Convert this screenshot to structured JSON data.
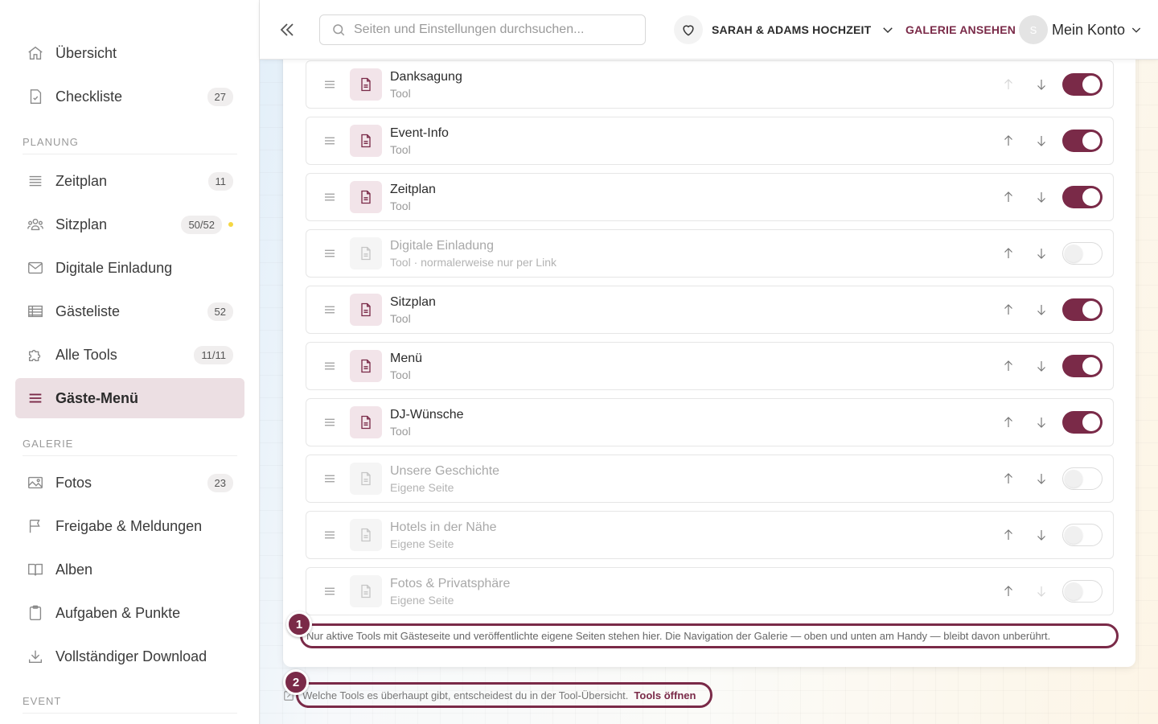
{
  "sidebar": {
    "items_top": [
      {
        "label": "Übersicht",
        "badge": ""
      },
      {
        "label": "Checkliste",
        "badge": "27"
      }
    ],
    "section_planung": "PLANUNG",
    "items_planung": [
      {
        "label": "Zeitplan",
        "badge": "11"
      },
      {
        "label": "Sitzplan",
        "badge": "50/52"
      },
      {
        "label": "Digitale Einladung",
        "badge": ""
      },
      {
        "label": "Gästeliste",
        "badge": "52"
      },
      {
        "label": "Alle Tools",
        "badge": "11/11"
      },
      {
        "label": "Gäste-Menü",
        "badge": ""
      }
    ],
    "section_galerie": "GALERIE",
    "items_galerie": [
      {
        "label": "Fotos",
        "badge": "23"
      },
      {
        "label": "Freigabe & Meldungen",
        "badge": ""
      },
      {
        "label": "Alben",
        "badge": ""
      },
      {
        "label": "Aufgaben & Punkte",
        "badge": ""
      },
      {
        "label": "Vollständiger Download",
        "badge": ""
      }
    ],
    "section_event": "EVENT"
  },
  "header": {
    "search_placeholder": "Seiten und Einstellungen durchsuchen...",
    "event_name": "SARAH & ADAMS HOCHZEIT",
    "gallery_link": "GALERIE ANSEHEN",
    "avatar_initial": "S",
    "account_label": "Mein Konto"
  },
  "menu_rows": [
    {
      "title": "Danksagung",
      "subtitle": "Tool",
      "enabled": true
    },
    {
      "title": "Event-Info",
      "subtitle": "Tool",
      "enabled": true
    },
    {
      "title": "Zeitplan",
      "subtitle": "Tool",
      "enabled": true
    },
    {
      "title": "Digitale Einladung",
      "subtitle": "Tool · normalerweise nur per Link",
      "enabled": false
    },
    {
      "title": "Sitzplan",
      "subtitle": "Tool",
      "enabled": true
    },
    {
      "title": "Menü",
      "subtitle": "Tool",
      "enabled": true
    },
    {
      "title": "DJ-Wünsche",
      "subtitle": "Tool",
      "enabled": true
    },
    {
      "title": "Unsere Geschichte",
      "subtitle": "Eigene Seite",
      "enabled": false
    },
    {
      "title": "Hotels in der Nähe",
      "subtitle": "Eigene Seite",
      "enabled": false
    },
    {
      "title": "Fotos & Privatsphäre",
      "subtitle": "Eigene Seite",
      "enabled": false
    }
  ],
  "hints": {
    "marker1": "1",
    "hint1_text": "Nur aktive Tools mit Gästeseite und veröffentlichte eigene Seiten stehen hier. Die Navigation der Galerie — oben und unten am Handy — bleibt davon unberührt.",
    "marker2": "2",
    "hint2_text": "Welche Tools es überhaupt gibt, entscheidest du in der Tool-Übersicht.",
    "hint2_link": "Tools öffnen"
  },
  "colors": {
    "accent": "#7a2a48",
    "active_bg": "#ecdfe3",
    "badge_dot": "#f5d742"
  }
}
